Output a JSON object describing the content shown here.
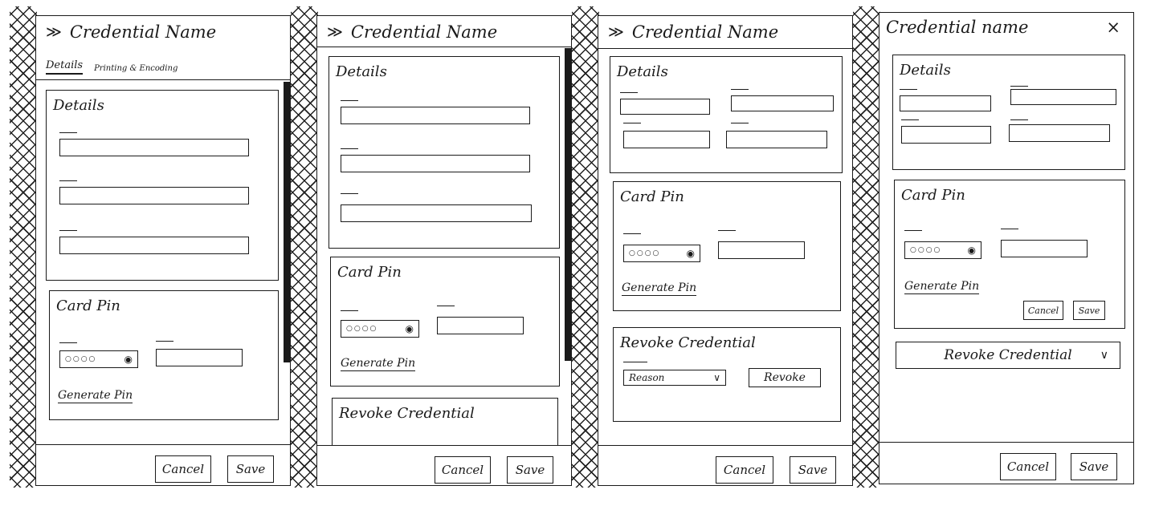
{
  "variant1": {
    "title": "Credential Name",
    "expand_icon": "≫",
    "tabs": [
      "Details",
      "Printing & Encoding"
    ],
    "details_title": "Details",
    "pin_title": "Card Pin",
    "pin_mask": "○○○○",
    "eye_icon": "◉",
    "generate_pin": "Generate Pin",
    "cancel": "Cancel",
    "save": "Save"
  },
  "variant2": {
    "title": "Credential Name",
    "expand_icon": "≫",
    "details_title": "Details",
    "pin_title": "Card Pin",
    "pin_mask": "○○○○",
    "eye_icon": "◉",
    "generate_pin": "Generate Pin",
    "revoke_title": "Revoke Credential",
    "cancel": "Cancel",
    "save": "Save"
  },
  "variant3": {
    "title": "Credential Name",
    "expand_icon": "≫",
    "details_title": "Details",
    "pin_title": "Card Pin",
    "pin_mask": "○○○○",
    "eye_icon": "◉",
    "generate_pin": "Generate Pin",
    "revoke_title": "Revoke Credential",
    "reason_select": "Reason",
    "chevron": "∨",
    "revoke_button": "Revoke",
    "cancel": "Cancel",
    "save": "Save"
  },
  "variant4": {
    "title": "Credential name",
    "close_icon": "×",
    "details_title": "Details",
    "pin_title": "Card Pin",
    "pin_mask": "○○○○",
    "eye_icon": "◉",
    "generate_pin": "Generate Pin",
    "pin_cancel": "Cancel",
    "pin_save": "Save",
    "revoke_accordion": "Revoke Credential",
    "chevron": "∨",
    "cancel": "Cancel",
    "save": "Save"
  }
}
